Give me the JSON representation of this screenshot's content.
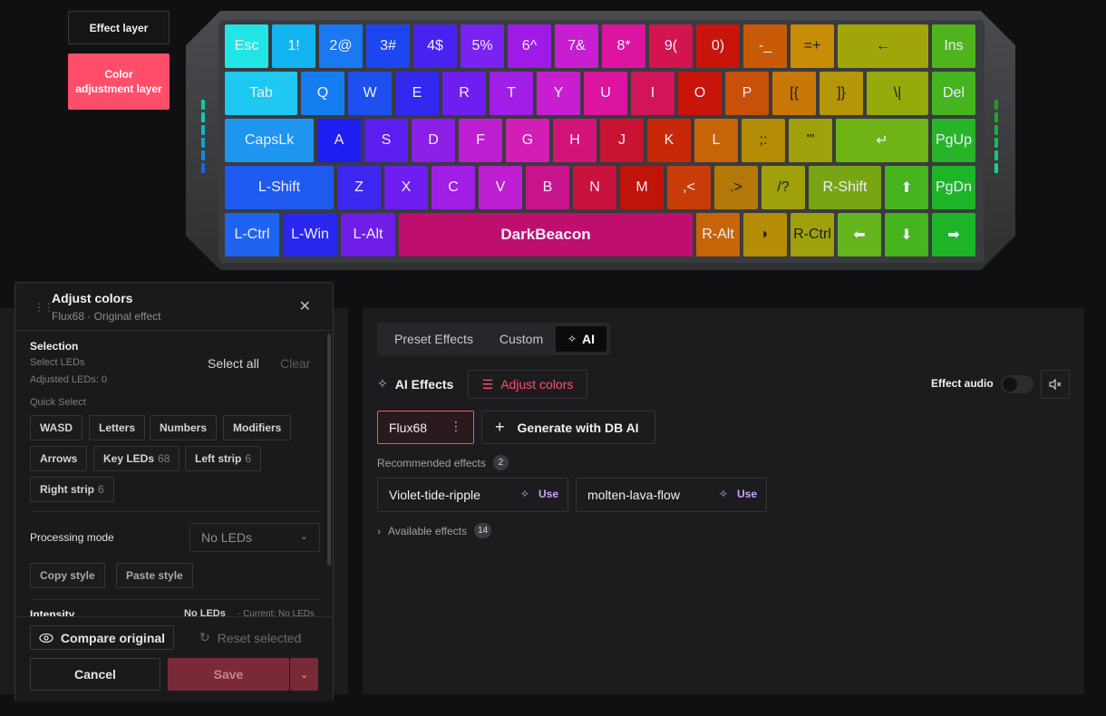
{
  "layers": {
    "effect_layer": "Effect layer",
    "color_adjustment_layer": "Color adjustment layer"
  },
  "keyboard": {
    "rows": [
      [
        {
          "label": "Esc",
          "color": "#22e6e6",
          "w": 48
        },
        {
          "label": "1!",
          "color": "#14b4f0",
          "w": 48
        },
        {
          "label": "2@",
          "color": "#1a78f0",
          "w": 48
        },
        {
          "label": "3#",
          "color": "#1e46f0",
          "w": 48
        },
        {
          "label": "4$",
          "color": "#4a22f0",
          "w": 48
        },
        {
          "label": "5%",
          "color": "#7a22f0",
          "w": 48
        },
        {
          "label": "6^",
          "color": "#a01ae6",
          "w": 48
        },
        {
          "label": "7&",
          "color": "#c81ed2",
          "w": 48
        },
        {
          "label": "8*",
          "color": "#dc14a0",
          "w": 48
        },
        {
          "label": "9(",
          "color": "#d21450",
          "w": 48
        },
        {
          "label": "0)",
          "color": "#c8140a",
          "w": 48
        },
        {
          "label": "-_",
          "color": "#c85a08",
          "w": 48
        },
        {
          "label": "=+",
          "color": "#c88c06",
          "w": 48
        },
        {
          "label": "←",
          "color": "#a0a50a",
          "w": 100
        },
        {
          "label": "Ins",
          "color": "#50b41e",
          "w": 48
        }
      ],
      [
        {
          "label": "Tab",
          "color": "#1ec8f0",
          "w": 80
        },
        {
          "label": "Q",
          "color": "#147ef0",
          "w": 48
        },
        {
          "label": "W",
          "color": "#1e50f0",
          "w": 48
        },
        {
          "label": "E",
          "color": "#3228f0",
          "w": 48
        },
        {
          "label": "R",
          "color": "#6e1ef0",
          "w": 48
        },
        {
          "label": "T",
          "color": "#a01ee6",
          "w": 48
        },
        {
          "label": "Y",
          "color": "#c81ed2",
          "w": 48
        },
        {
          "label": "U",
          "color": "#dc14a0",
          "w": 48
        },
        {
          "label": "I",
          "color": "#d2145a",
          "w": 48
        },
        {
          "label": "O",
          "color": "#c8140a",
          "w": 48
        },
        {
          "label": "P",
          "color": "#c85008",
          "w": 48
        },
        {
          "label": "[{",
          "color": "#c87808",
          "w": 48
        },
        {
          "label": "]}",
          "color": "#b49606",
          "w": 48
        },
        {
          "label": "\\|",
          "color": "#96aa0a",
          "w": 68
        },
        {
          "label": "Del",
          "color": "#46b41e",
          "w": 48
        }
      ],
      [
        {
          "label": "CapsLk",
          "color": "#1e96f0",
          "w": 98
        },
        {
          "label": "A",
          "color": "#1e1ef0",
          "w": 48
        },
        {
          "label": "S",
          "color": "#5a1ef0",
          "w": 48
        },
        {
          "label": "D",
          "color": "#8c1ee6",
          "w": 48
        },
        {
          "label": "F",
          "color": "#be1ed2",
          "w": 48
        },
        {
          "label": "G",
          "color": "#d21eb4",
          "w": 48
        },
        {
          "label": "H",
          "color": "#d21478",
          "w": 48
        },
        {
          "label": "J",
          "color": "#c81432",
          "w": 48
        },
        {
          "label": "K",
          "color": "#c82808",
          "w": 48
        },
        {
          "label": "L",
          "color": "#c86408",
          "w": 48
        },
        {
          "label": ";:",
          "color": "#b48c06",
          "w": 48
        },
        {
          "label": "'\"",
          "color": "#a0a00a",
          "w": 48
        },
        {
          "label": "↵",
          "color": "#6eb414",
          "w": 102
        },
        {
          "label": "PgUp",
          "color": "#28b428",
          "w": 48
        }
      ],
      [
        {
          "label": "L-Shift",
          "color": "#1e5af0",
          "w": 120
        },
        {
          "label": "Z",
          "color": "#3c28f0",
          "w": 48
        },
        {
          "label": "X",
          "color": "#6e1ef0",
          "w": 48
        },
        {
          "label": "C",
          "color": "#a01ee6",
          "w": 48
        },
        {
          "label": "V",
          "color": "#be1ed2",
          "w": 48
        },
        {
          "label": "B",
          "color": "#c8148c",
          "w": 48
        },
        {
          "label": "N",
          "color": "#c8143c",
          "w": 48
        },
        {
          "label": "M",
          "color": "#be140a",
          "w": 48
        },
        {
          "label": ",<",
          "color": "#c83c08",
          "w": 48
        },
        {
          "label": ".>",
          "color": "#b47808",
          "w": 48
        },
        {
          "label": "/?",
          "color": "#a0a00a",
          "w": 48
        },
        {
          "label": "R-Shift",
          "color": "#78a514",
          "w": 80
        },
        {
          "label": "⬆",
          "color": "#46b41e",
          "w": 48
        },
        {
          "label": "PgDn",
          "color": "#1eb428",
          "w": 48
        }
      ],
      [
        {
          "label": "L-Ctrl",
          "color": "#1e64f0",
          "w": 60
        },
        {
          "label": "L-Win",
          "color": "#2828f0",
          "w": 60
        },
        {
          "label": "L-Alt",
          "color": "#6e1ee6",
          "w": 60
        },
        {
          "label": "DarkBeacon",
          "color": "#be0f6e",
          "w": 324
        },
        {
          "label": "R-Alt",
          "color": "#c86408",
          "w": 48
        },
        {
          "label": "◗",
          "color": "#b48c06",
          "w": 48
        },
        {
          "label": "R-Ctrl",
          "color": "#a0a00a",
          "w": 48
        },
        {
          "label": "⬅",
          "color": "#64b41e",
          "w": 48
        },
        {
          "label": "⬇",
          "color": "#46b41e",
          "w": 48
        },
        {
          "label": "➡",
          "color": "#1eb428",
          "w": 48
        }
      ]
    ],
    "left_strip": [
      "#14c8a0",
      "#14c8b4",
      "#14b4c8",
      "#14a0d2",
      "#148cdc",
      "#1e64e6"
    ],
    "right_strip": [
      "#14a028",
      "#14aa32",
      "#14b446",
      "#14be5a",
      "#14c878",
      "#14d296"
    ]
  },
  "modal": {
    "title": "Adjust colors",
    "subtitle": "Flux68  ·  Original effect",
    "selection_label": "Selection",
    "select_leds": "Select LEDs",
    "adjusted_leds": "Adjusted LEDs: 0",
    "select_all": "Select all",
    "clear": "Clear",
    "quick_select": "Quick Select",
    "chips": [
      {
        "label": "WASD",
        "count": ""
      },
      {
        "label": "Letters",
        "count": ""
      },
      {
        "label": "Numbers",
        "count": ""
      },
      {
        "label": "Modifiers",
        "count": ""
      },
      {
        "label": "Arrows",
        "count": ""
      },
      {
        "label": "Key LEDs",
        "count": "68"
      },
      {
        "label": "Left strip",
        "count": "6"
      },
      {
        "label": "Right strip",
        "count": "6"
      }
    ],
    "processing_mode": "Processing mode",
    "processing_value": "No LEDs",
    "copy_style": "Copy style",
    "paste_style": "Paste style",
    "intensity": "Intensity",
    "intensity_value": "No LEDs",
    "intensity_current": "· Current: No LEDs",
    "compare_original": "Compare original",
    "reset_selected": "Reset selected",
    "cancel": "Cancel",
    "save": "Save"
  },
  "right": {
    "tabs": [
      "Preset Effects",
      "Custom",
      "AI"
    ],
    "ai_effects": "AI Effects",
    "adjust_colors": "Adjust colors",
    "effect_audio": "Effect audio",
    "current_effect": "Flux68",
    "generate": "Generate with DB AI",
    "recommended_label": "Recommended effects",
    "recommended_count": "2",
    "recommended": [
      {
        "name": "Violet-tide-ripple",
        "use": "Use"
      },
      {
        "name": "molten-lava-flow",
        "use": "Use"
      }
    ],
    "available_label": "Available effects",
    "available_count": "14"
  },
  "colors": {
    "accent": "#ff4d6a",
    "ai_purple": "#c9a2ff"
  }
}
